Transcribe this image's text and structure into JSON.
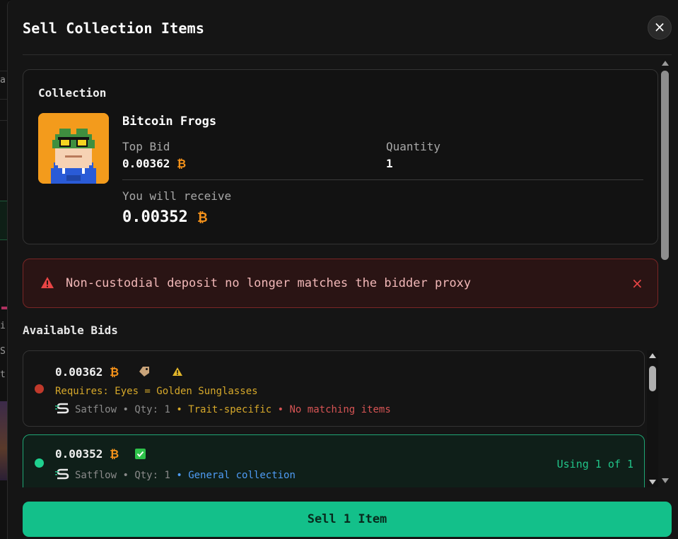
{
  "modal": {
    "title": "Sell Collection Items",
    "close_label": "×"
  },
  "collection": {
    "section_label": "Collection",
    "name": "Bitcoin Frogs",
    "top_bid_label": "Top Bid",
    "top_bid_value": "0.00362",
    "quantity_label": "Quantity",
    "quantity_value": "1",
    "receive_label": "You will receive",
    "receive_value": "0.00352",
    "btc_symbol": "₿"
  },
  "error": {
    "message": "Non-custodial deposit no longer matches the bidder proxy",
    "dismiss": "×"
  },
  "bids": {
    "section_label": "Available Bids",
    "items": [
      {
        "price": "0.00362",
        "status_color": "#c0392b",
        "requirement": "Requires: Eyes = Golden Sunglasses",
        "marketplace": "Satflow",
        "qty": "Qty: 1",
        "bid_type": "Trait-specific",
        "note": "No matching items",
        "icons": [
          "tag-icon",
          "warning-icon"
        ]
      },
      {
        "price": "0.00352",
        "status_color": "#1fd18f",
        "marketplace": "Satflow",
        "qty": "Qty: 1",
        "bid_type": "General collection",
        "using": "Using 1 of 1",
        "icons": [
          "check-icon"
        ]
      }
    ]
  },
  "sell_button_label": "Sell 1 Item",
  "background_app": {
    "fragments": [
      "a:",
      "i",
      "S",
      "t"
    ]
  }
}
